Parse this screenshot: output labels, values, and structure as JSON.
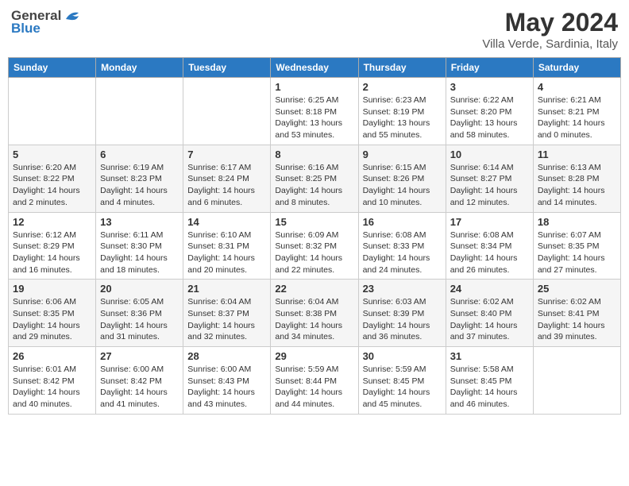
{
  "header": {
    "logo_general": "General",
    "logo_blue": "Blue",
    "month_year": "May 2024",
    "location": "Villa Verde, Sardinia, Italy"
  },
  "days_of_week": [
    "Sunday",
    "Monday",
    "Tuesday",
    "Wednesday",
    "Thursday",
    "Friday",
    "Saturday"
  ],
  "weeks": [
    [
      {
        "day": "",
        "info": ""
      },
      {
        "day": "",
        "info": ""
      },
      {
        "day": "",
        "info": ""
      },
      {
        "day": "1",
        "sunrise": "6:25 AM",
        "sunset": "8:18 PM",
        "daylight": "13 hours and 53 minutes."
      },
      {
        "day": "2",
        "sunrise": "6:23 AM",
        "sunset": "8:19 PM",
        "daylight": "13 hours and 55 minutes."
      },
      {
        "day": "3",
        "sunrise": "6:22 AM",
        "sunset": "8:20 PM",
        "daylight": "13 hours and 58 minutes."
      },
      {
        "day": "4",
        "sunrise": "6:21 AM",
        "sunset": "8:21 PM",
        "daylight": "14 hours and 0 minutes."
      }
    ],
    [
      {
        "day": "5",
        "sunrise": "6:20 AM",
        "sunset": "8:22 PM",
        "daylight": "14 hours and 2 minutes."
      },
      {
        "day": "6",
        "sunrise": "6:19 AM",
        "sunset": "8:23 PM",
        "daylight": "14 hours and 4 minutes."
      },
      {
        "day": "7",
        "sunrise": "6:17 AM",
        "sunset": "8:24 PM",
        "daylight": "14 hours and 6 minutes."
      },
      {
        "day": "8",
        "sunrise": "6:16 AM",
        "sunset": "8:25 PM",
        "daylight": "14 hours and 8 minutes."
      },
      {
        "day": "9",
        "sunrise": "6:15 AM",
        "sunset": "8:26 PM",
        "daylight": "14 hours and 10 minutes."
      },
      {
        "day": "10",
        "sunrise": "6:14 AM",
        "sunset": "8:27 PM",
        "daylight": "14 hours and 12 minutes."
      },
      {
        "day": "11",
        "sunrise": "6:13 AM",
        "sunset": "8:28 PM",
        "daylight": "14 hours and 14 minutes."
      }
    ],
    [
      {
        "day": "12",
        "sunrise": "6:12 AM",
        "sunset": "8:29 PM",
        "daylight": "14 hours and 16 minutes."
      },
      {
        "day": "13",
        "sunrise": "6:11 AM",
        "sunset": "8:30 PM",
        "daylight": "14 hours and 18 minutes."
      },
      {
        "day": "14",
        "sunrise": "6:10 AM",
        "sunset": "8:31 PM",
        "daylight": "14 hours and 20 minutes."
      },
      {
        "day": "15",
        "sunrise": "6:09 AM",
        "sunset": "8:32 PM",
        "daylight": "14 hours and 22 minutes."
      },
      {
        "day": "16",
        "sunrise": "6:08 AM",
        "sunset": "8:33 PM",
        "daylight": "14 hours and 24 minutes."
      },
      {
        "day": "17",
        "sunrise": "6:08 AM",
        "sunset": "8:34 PM",
        "daylight": "14 hours and 26 minutes."
      },
      {
        "day": "18",
        "sunrise": "6:07 AM",
        "sunset": "8:35 PM",
        "daylight": "14 hours and 27 minutes."
      }
    ],
    [
      {
        "day": "19",
        "sunrise": "6:06 AM",
        "sunset": "8:35 PM",
        "daylight": "14 hours and 29 minutes."
      },
      {
        "day": "20",
        "sunrise": "6:05 AM",
        "sunset": "8:36 PM",
        "daylight": "14 hours and 31 minutes."
      },
      {
        "day": "21",
        "sunrise": "6:04 AM",
        "sunset": "8:37 PM",
        "daylight": "14 hours and 32 minutes."
      },
      {
        "day": "22",
        "sunrise": "6:04 AM",
        "sunset": "8:38 PM",
        "daylight": "14 hours and 34 minutes."
      },
      {
        "day": "23",
        "sunrise": "6:03 AM",
        "sunset": "8:39 PM",
        "daylight": "14 hours and 36 minutes."
      },
      {
        "day": "24",
        "sunrise": "6:02 AM",
        "sunset": "8:40 PM",
        "daylight": "14 hours and 37 minutes."
      },
      {
        "day": "25",
        "sunrise": "6:02 AM",
        "sunset": "8:41 PM",
        "daylight": "14 hours and 39 minutes."
      }
    ],
    [
      {
        "day": "26",
        "sunrise": "6:01 AM",
        "sunset": "8:42 PM",
        "daylight": "14 hours and 40 minutes."
      },
      {
        "day": "27",
        "sunrise": "6:00 AM",
        "sunset": "8:42 PM",
        "daylight": "14 hours and 41 minutes."
      },
      {
        "day": "28",
        "sunrise": "6:00 AM",
        "sunset": "8:43 PM",
        "daylight": "14 hours and 43 minutes."
      },
      {
        "day": "29",
        "sunrise": "5:59 AM",
        "sunset": "8:44 PM",
        "daylight": "14 hours and 44 minutes."
      },
      {
        "day": "30",
        "sunrise": "5:59 AM",
        "sunset": "8:45 PM",
        "daylight": "14 hours and 45 minutes."
      },
      {
        "day": "31",
        "sunrise": "5:58 AM",
        "sunset": "8:45 PM",
        "daylight": "14 hours and 46 minutes."
      },
      {
        "day": "",
        "info": ""
      }
    ]
  ],
  "labels": {
    "sunrise": "Sunrise:",
    "sunset": "Sunset:",
    "daylight": "Daylight:"
  }
}
